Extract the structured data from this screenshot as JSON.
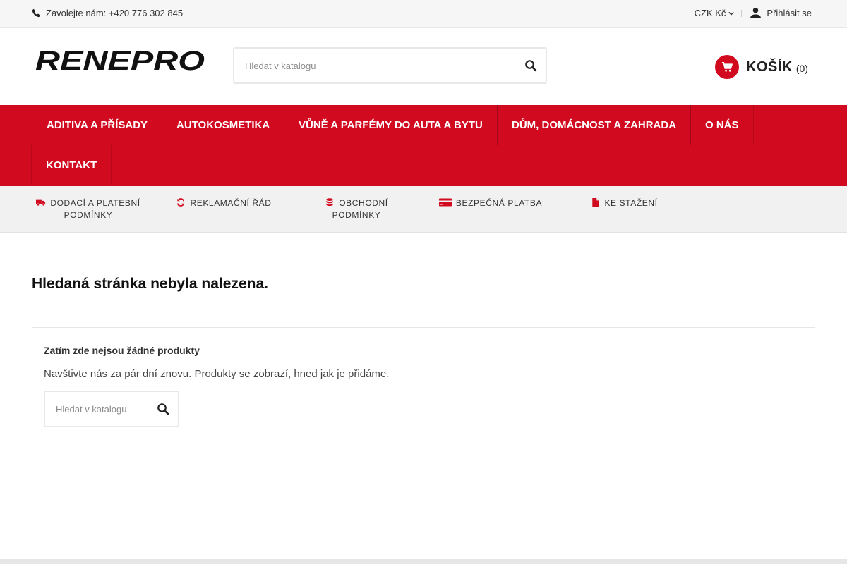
{
  "topbar": {
    "phone": "Zavolejte nám: +420 776 302 845",
    "currency": "CZK Kč",
    "login": "Přihlásit se"
  },
  "header": {
    "logo_text": "RENEPRO",
    "search_placeholder": "Hledat v katalogu",
    "cart_label": "KOŠÍK",
    "cart_count": "(0)"
  },
  "nav": {
    "items": [
      "ADITIVA A PŘÍSADY",
      "AUTOKOSMETIKA",
      "VŮNĚ A PARFÉMY DO AUTA A BYTU",
      "DŮM, DOMÁCNOST A ZAHRADA",
      "O NÁS",
      "KONTAKT"
    ]
  },
  "info_strip": {
    "items": [
      {
        "icon": "truck-icon",
        "line1": "DODACÍ A PLATEBNÍ",
        "line2": "PODMÍNKY"
      },
      {
        "icon": "refresh-icon",
        "line1": "REKLAMAČNÍ ŘÁD",
        "line2": ""
      },
      {
        "icon": "database-icon",
        "line1": "OBCHODNÍ",
        "line2": "PODMÍNKY"
      },
      {
        "icon": "credit-card-icon",
        "line1": "BEZPEČNÁ PLATBA",
        "line2": ""
      },
      {
        "icon": "file-icon",
        "line1": "KE STAŽENÍ",
        "line2": ""
      }
    ]
  },
  "main": {
    "title": "Hledaná stránka nebyla nalezena.",
    "empty_heading": "Zatím zde nejsou žádné produkty",
    "empty_text": "Navštivte nás za pár dní znovu. Produkty se zobrazí, hned jak je přidáme.",
    "search_placeholder": "Hledat v katalogu"
  },
  "colors": {
    "accent": "#d20a20",
    "topbar_bg": "#f6f6f6",
    "strip_bg": "#f1f1f1"
  }
}
